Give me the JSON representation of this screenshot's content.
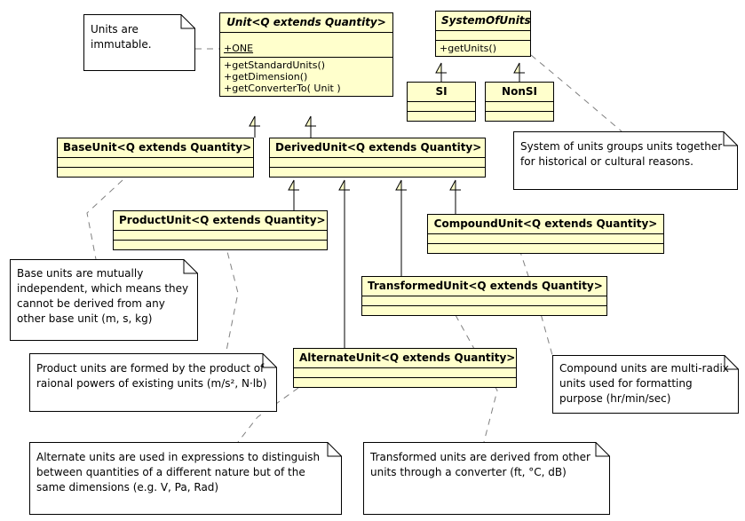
{
  "diagram": {
    "title": "JScience Unit class hierarchy",
    "colors": {
      "class_fill": "#ffffcc",
      "note_fill": "#ffffff",
      "stroke": "#000000",
      "link": "#808080"
    }
  },
  "classes": {
    "unit": {
      "name": "Unit<Q extends Quantity>",
      "attributes": [
        "+ONE"
      ],
      "operations": [
        "+getStandardUnits()",
        "+getDimension()",
        "+getConverterTo( Unit )"
      ]
    },
    "system_of_units": {
      "name": "SystemOfUnits",
      "attributes": [],
      "operations": [
        "+getUnits()"
      ]
    },
    "si": {
      "name": "SI",
      "attributes": [],
      "operations": []
    },
    "nonsi": {
      "name": "NonSI",
      "attributes": [],
      "operations": []
    },
    "base_unit": {
      "name": "BaseUnit<Q extends Quantity>",
      "attributes": [],
      "operations": []
    },
    "derived_unit": {
      "name": "DerivedUnit<Q extends Quantity>",
      "attributes": [],
      "operations": []
    },
    "product_unit": {
      "name": "ProductUnit<Q extends Quantity>",
      "attributes": [],
      "operations": []
    },
    "compound_unit": {
      "name": "CompoundUnit<Q extends Quantity>",
      "attributes": [],
      "operations": []
    },
    "transformed_unit": {
      "name": "TransformedUnit<Q extends Quantity>",
      "attributes": [],
      "operations": []
    },
    "alternate_unit": {
      "name": "AlternateUnit<Q extends Quantity>",
      "attributes": [],
      "operations": []
    }
  },
  "notes": {
    "immutable": "Units are\nimmutable.",
    "system_of_units": "System of units groups units together\nfor historical or cultural reasons.",
    "base_units": "Base units are mutually\nindependent, which means they\ncannot be derived from any\nother base unit (m, s, kg)",
    "product_units": "Product units are formed by the product of\nraional powers of existing units (m/s², N·lb)",
    "alternate_units": "Alternate units are used in expressions to distinguish\nbetween quantities of a different nature but of the\nsame dimensions (e.g. V, Pa, Rad)",
    "transformed_units": "Transformed units are derived from other\nunits through a converter (ft, °C, dB)",
    "compound_units": "Compound units are multi-radix\nunits used for formatting\npurpose (hr/min/sec)"
  }
}
